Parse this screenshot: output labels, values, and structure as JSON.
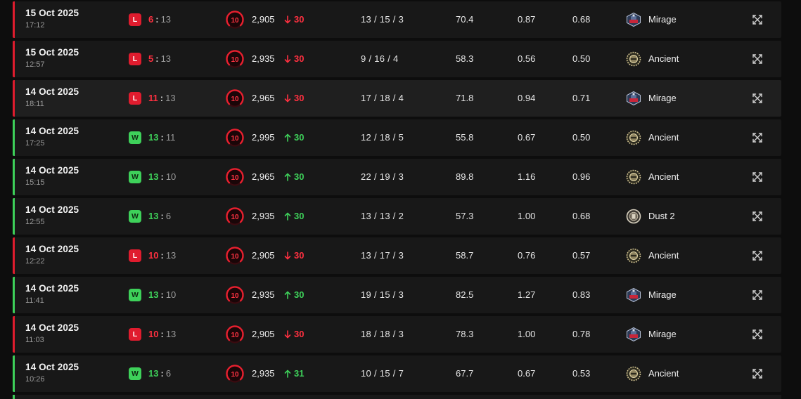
{
  "colors": {
    "loss": "#e01c2e",
    "win": "#3ed15a",
    "row_bg": "#181818",
    "page_bg": "#0d0d0d"
  },
  "icons": {
    "level": "faceit-level-10-icon",
    "delta_up": "arrow-up-icon",
    "delta_down": "arrow-down-icon",
    "details": "expand-arrows-icon"
  },
  "matches": [
    {
      "result": "loss",
      "result_letter": "L",
      "date": "15 Oct 2025",
      "time": "17:12",
      "score_own": "6",
      "score_sep": ":",
      "score_opp": "13",
      "level": "10",
      "elo": "2,905",
      "elo_delta": "30",
      "kda": "13 / 15 / 3",
      "adr": "70.4",
      "kd": "0.87",
      "kr": "0.68",
      "map": "Mirage",
      "map_icon": "mirage"
    },
    {
      "result": "loss",
      "result_letter": "L",
      "date": "15 Oct 2025",
      "time": "12:57",
      "score_own": "5",
      "score_sep": ":",
      "score_opp": "13",
      "level": "10",
      "elo": "2,935",
      "elo_delta": "30",
      "kda": "9 / 16 / 4",
      "adr": "58.3",
      "kd": "0.56",
      "kr": "0.50",
      "map": "Ancient",
      "map_icon": "ancient"
    },
    {
      "result": "loss",
      "result_letter": "L",
      "date": "14 Oct 2025",
      "time": "18:11",
      "score_own": "11",
      "score_sep": ":",
      "score_opp": "13",
      "level": "10",
      "elo": "2,965",
      "elo_delta": "30",
      "kda": "17 / 18 / 4",
      "adr": "71.8",
      "kd": "0.94",
      "kr": "0.71",
      "map": "Mirage",
      "map_icon": "mirage",
      "highlighted": true
    },
    {
      "result": "win",
      "result_letter": "W",
      "date": "14 Oct 2025",
      "time": "17:25",
      "score_own": "13",
      "score_sep": ":",
      "score_opp": "11",
      "level": "10",
      "elo": "2,995",
      "elo_delta": "30",
      "kda": "12 / 18 / 5",
      "adr": "55.8",
      "kd": "0.67",
      "kr": "0.50",
      "map": "Ancient",
      "map_icon": "ancient"
    },
    {
      "result": "win",
      "result_letter": "W",
      "date": "14 Oct 2025",
      "time": "15:15",
      "score_own": "13",
      "score_sep": ":",
      "score_opp": "10",
      "level": "10",
      "elo": "2,965",
      "elo_delta": "30",
      "kda": "22 / 19 / 3",
      "adr": "89.8",
      "kd": "1.16",
      "kr": "0.96",
      "map": "Ancient",
      "map_icon": "ancient"
    },
    {
      "result": "win",
      "result_letter": "W",
      "date": "14 Oct 2025",
      "time": "12:55",
      "score_own": "13",
      "score_sep": ":",
      "score_opp": "6",
      "level": "10",
      "elo": "2,935",
      "elo_delta": "30",
      "kda": "13 / 13 / 2",
      "adr": "57.3",
      "kd": "1.00",
      "kr": "0.68",
      "map": "Dust 2",
      "map_icon": "dust2"
    },
    {
      "result": "loss",
      "result_letter": "L",
      "date": "14 Oct 2025",
      "time": "12:22",
      "score_own": "10",
      "score_sep": ":",
      "score_opp": "13",
      "level": "10",
      "elo": "2,905",
      "elo_delta": "30",
      "kda": "13 / 17 / 3",
      "adr": "58.7",
      "kd": "0.76",
      "kr": "0.57",
      "map": "Ancient",
      "map_icon": "ancient"
    },
    {
      "result": "win",
      "result_letter": "W",
      "date": "14 Oct 2025",
      "time": "11:41",
      "score_own": "13",
      "score_sep": ":",
      "score_opp": "10",
      "level": "10",
      "elo": "2,935",
      "elo_delta": "30",
      "kda": "19 / 15 / 3",
      "adr": "82.5",
      "kd": "1.27",
      "kr": "0.83",
      "map": "Mirage",
      "map_icon": "mirage"
    },
    {
      "result": "loss",
      "result_letter": "L",
      "date": "14 Oct 2025",
      "time": "11:03",
      "score_own": "10",
      "score_sep": ":",
      "score_opp": "13",
      "level": "10",
      "elo": "2,905",
      "elo_delta": "30",
      "kda": "18 / 18 / 3",
      "adr": "78.3",
      "kd": "1.00",
      "kr": "0.78",
      "map": "Mirage",
      "map_icon": "mirage"
    },
    {
      "result": "win",
      "result_letter": "W",
      "date": "14 Oct 2025",
      "time": "10:26",
      "score_own": "13",
      "score_sep": ":",
      "score_opp": "6",
      "level": "10",
      "elo": "2,935",
      "elo_delta": "31",
      "kda": "10 / 15 / 7",
      "adr": "67.7",
      "kd": "0.67",
      "kr": "0.53",
      "map": "Ancient",
      "map_icon": "ancient"
    }
  ]
}
